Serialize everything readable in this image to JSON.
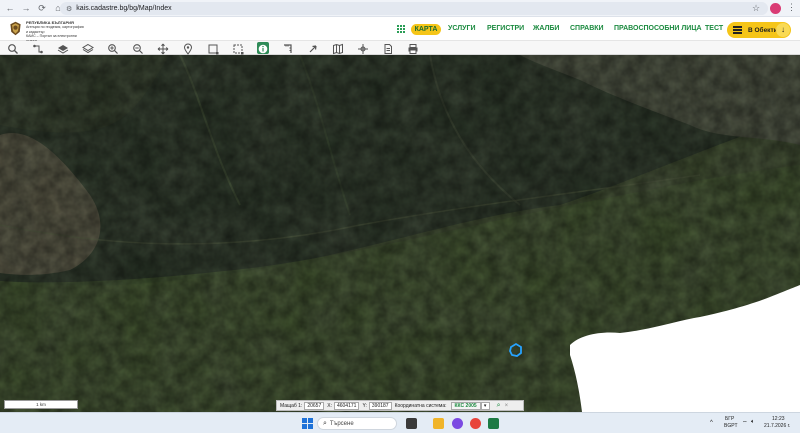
{
  "browser": {
    "url": "kais.cadastre.bg/bg/Map/Index",
    "nav": {
      "back": "←",
      "forward": "→",
      "reload": "⟳",
      "home": "⌂"
    },
    "star": "☆",
    "menu": "⋮"
  },
  "site": {
    "logo_line1": "РЕПУБЛИКА БЪЛГАРИЯ",
    "logo_line2": "Агенция по геодезия, картография и кадастър",
    "logo_line3": "КАИС – Портал за електронни услуги",
    "menu": [
      {
        "label": "КАРТА",
        "active": true
      },
      {
        "label": "УСЛУГИ"
      },
      {
        "label": "РЕГИСТРИ"
      },
      {
        "label": "ЖАЛБИ"
      },
      {
        "label": "СПРАВКИ"
      },
      {
        "label": "ПРАВОСПОСОБНИ ЛИЦА"
      },
      {
        "label": "ТЕСТ"
      }
    ],
    "objects_button": "В Обекти",
    "accent_color": "#f5c518",
    "menu_color": "#1b8a3f"
  },
  "toolbar": {
    "tools": [
      "search-icon",
      "route-icon",
      "layers-stack-icon",
      "layers-icon",
      "zoom-in-icon",
      "zoom-out-icon",
      "pan-icon",
      "location-pin-icon",
      "select-rectangle-icon",
      "select-polygon-icon",
      "info-icon",
      "measure-icon",
      "pointer-icon",
      "map-book-icon",
      "crosshair-icon",
      "document-icon",
      "print-icon"
    ],
    "active_tool": "info-icon"
  },
  "map": {
    "scale_label": "1 km"
  },
  "coordinates": {
    "scale_label": "Мащаб 1:",
    "scale_value": "20657",
    "x_label": "X:",
    "x_value": "4604171",
    "y_label": "Y:",
    "y_value": "390187",
    "system_label": "Координатна система:",
    "system_value": "ККС 2005"
  },
  "taskbar": {
    "search_placeholder": "Търсене",
    "lang_line1": "БГР",
    "lang_line2": "BGPT",
    "time": "12:23",
    "date": "21.7.2026 г."
  }
}
